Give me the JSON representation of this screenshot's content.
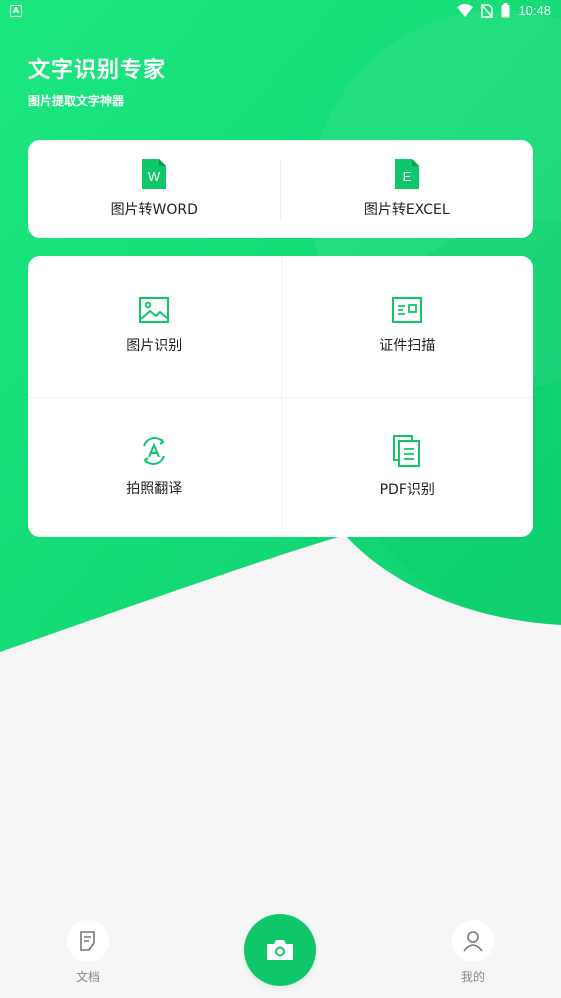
{
  "status_bar": {
    "time": "10:48"
  },
  "header": {
    "title": "文字识别专家",
    "subtitle": "图片提取文字神器"
  },
  "top_tools": [
    {
      "icon_letter": "W",
      "label": "图片转WORD",
      "icon": "word-file-icon"
    },
    {
      "icon_letter": "E",
      "label": "图片转EXCEL",
      "icon": "excel-file-icon"
    }
  ],
  "grid_tools": [
    {
      "label": "图片识别",
      "icon": "image-icon"
    },
    {
      "label": "证件扫描",
      "icon": "id-card-icon"
    },
    {
      "label": "拍照翻译",
      "icon": "translate-icon"
    },
    {
      "label": "PDF识别",
      "icon": "pdf-document-icon"
    }
  ],
  "bottom_nav": {
    "documents": {
      "label": "文档",
      "icon": "document-icon"
    },
    "camera": {
      "icon": "camera-icon"
    },
    "mine": {
      "label": "我的",
      "icon": "user-icon"
    }
  },
  "colors": {
    "accent": "#0fc76a",
    "gradient_light": "#1ee882",
    "background": "#f6f6f6"
  }
}
